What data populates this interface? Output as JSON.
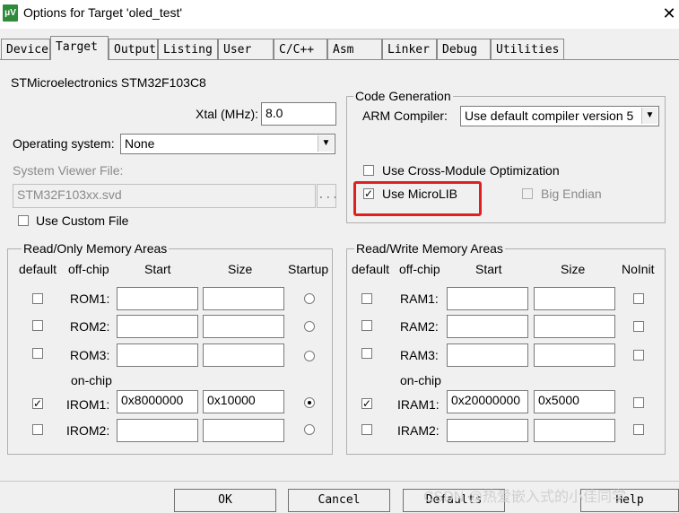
{
  "window": {
    "title": "Options for Target 'oled_test'",
    "icon": "uvision-app-icon",
    "close": "✕"
  },
  "tabs": [
    "Device",
    "Target",
    "Output",
    "Listing",
    "User",
    "C/C++",
    "Asm",
    "Linker",
    "Debug",
    "Utilities"
  ],
  "target": {
    "device": "STMicroelectronics STM32F103C8",
    "xtal_label": "Xtal (MHz):",
    "xtal_value": "8.0",
    "os_label": "Operating system:",
    "os_value": "None",
    "svf_label": "System Viewer File:",
    "svf_value": "STM32F103xx.svd",
    "browse": "...",
    "custom_file_label": "Use Custom File"
  },
  "codegen": {
    "title": "Code Generation",
    "compiler_label": "ARM Compiler:",
    "compiler_value": "Use default compiler version 5",
    "cross_module_label": "Use Cross-Module Optimization",
    "microlib_label": "Use MicroLIB",
    "big_endian_label": "Big Endian"
  },
  "ro": {
    "title": "Read/Only Memory Areas",
    "headers": {
      "default": "default",
      "offchip": "off-chip",
      "start": "Start",
      "size": "Size",
      "startup": "Startup"
    },
    "onchip": "on-chip",
    "rows": [
      {
        "name": "ROM1:",
        "start": "",
        "size": ""
      },
      {
        "name": "ROM2:",
        "start": "",
        "size": ""
      },
      {
        "name": "ROM3:",
        "start": "",
        "size": ""
      },
      {
        "name": "IROM1:",
        "start": "0x8000000",
        "size": "0x10000"
      },
      {
        "name": "IROM2:",
        "start": "",
        "size": ""
      }
    ]
  },
  "rw": {
    "title": "Read/Write Memory Areas",
    "headers": {
      "default": "default",
      "offchip": "off-chip",
      "start": "Start",
      "size": "Size",
      "noinit": "NoInit"
    },
    "onchip": "on-chip",
    "rows": [
      {
        "name": "RAM1:",
        "start": "",
        "size": ""
      },
      {
        "name": "RAM2:",
        "start": "",
        "size": ""
      },
      {
        "name": "RAM3:",
        "start": "",
        "size": ""
      },
      {
        "name": "IRAM1:",
        "start": "0x20000000",
        "size": "0x5000"
      },
      {
        "name": "IRAM2:",
        "start": "",
        "size": ""
      }
    ]
  },
  "buttons": {
    "ok": "OK",
    "cancel": "Cancel",
    "defaults": "Defaults",
    "help": "Help"
  },
  "watermark": "CSDN @热爱嵌入式的小佳同学",
  "colors": {
    "highlight": "#e02020",
    "accent": "#2e8b3a"
  }
}
